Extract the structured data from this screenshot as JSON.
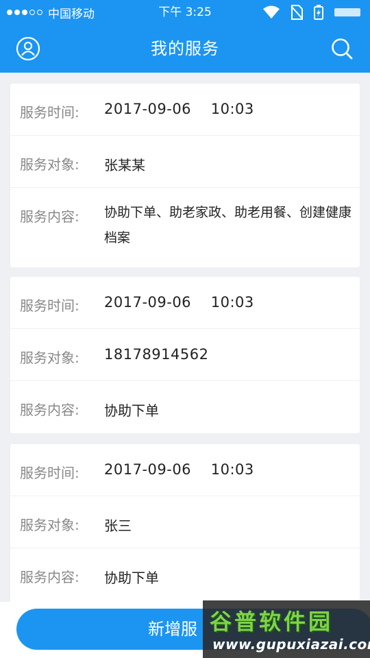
{
  "status_bar": {
    "carrier": "中国移动",
    "time": "下午 3:25"
  },
  "header": {
    "title": "我的服务"
  },
  "icons": {
    "user": "user-circle-icon",
    "search": "search-icon",
    "wifi": "wifi-icon",
    "no_sim": "no-sim-icon",
    "battery": "battery-icon",
    "signal": "signal-dots-icon"
  },
  "colors": {
    "primary": "#1b95f1",
    "background": "#eff0f4",
    "label": "#888888",
    "value": "#222222"
  },
  "services": [
    {
      "time_label": "服务时间:",
      "time": "2017-09-06    10:03",
      "target_label": "服务对象:",
      "target": "张某某",
      "content_label": "服务内容:",
      "content": "协助下单、助老家政、助老用餐、创建健康档案"
    },
    {
      "time_label": "服务时间:",
      "time": "2017-09-06    10:03",
      "target_label": "服务对象:",
      "target": "18178914562",
      "content_label": "服务内容:",
      "content": "协助下单"
    },
    {
      "time_label": "服务时间:",
      "time": "2017-09-06    10:03",
      "target_label": "服务对象:",
      "target": "张三",
      "content_label": "服务内容:",
      "content": "协助下单"
    }
  ],
  "bottom": {
    "add_button_label": "新增服"
  },
  "watermark": {
    "logo_text": "谷普软件园",
    "url": "www.gupuxiazai.com"
  }
}
